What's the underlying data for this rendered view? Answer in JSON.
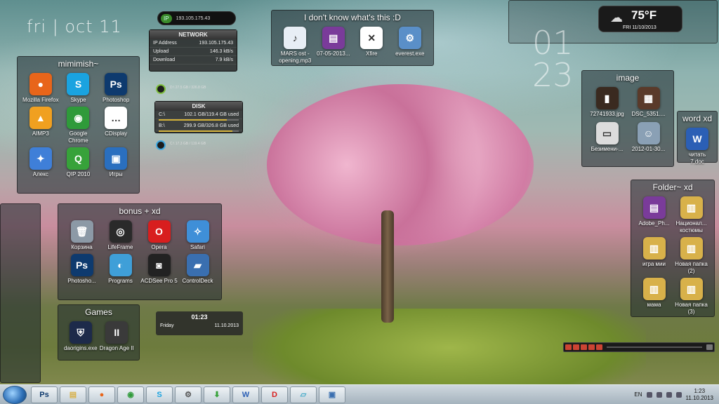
{
  "date_text": "fri | oct 11",
  "ip_widget": {
    "tag": "IP",
    "value": "193.105.175.43"
  },
  "network": {
    "title": "NETWORK",
    "rows": [
      {
        "label": "IP Address",
        "value": "193.105.175.43"
      },
      {
        "label": "Upload",
        "value": "146.3 kB/s"
      },
      {
        "label": "Download",
        "value": "7.9 kB/s"
      }
    ]
  },
  "drive_d_text": "D:\\ 27.5 GB / 326.8 GB",
  "drive_c_text": "C:\\ 17.3 GB / 119.4 GB",
  "disk": {
    "title": "DISK",
    "rows": [
      {
        "drive": "C:\\",
        "usage": "102.1 GB/119.4 GB used",
        "fill": 0.855
      },
      {
        "drive": "B:\\",
        "usage": "299.9 GB/326.8 GB used",
        "fill": 0.918
      }
    ]
  },
  "mimimish": {
    "title": "mimimish~",
    "items": [
      {
        "label": "Mozilla Firefox",
        "color": "#e8651a",
        "glyph": "●"
      },
      {
        "label": "Skype",
        "color": "#1aa3e0",
        "glyph": "S"
      },
      {
        "label": "Photoshop",
        "color": "#0e3a6e",
        "glyph": "Ps"
      },
      {
        "label": "AIMP3",
        "color": "#f0a020",
        "glyph": "▲"
      },
      {
        "label": "Google Chrome",
        "color": "#2f9a3a",
        "glyph": "◉"
      },
      {
        "label": "CDisplay",
        "color": "#ffffff",
        "glyph": "…"
      },
      {
        "label": "Алекс",
        "color": "#3f7fd8",
        "glyph": "✦"
      },
      {
        "label": "QIP 2010",
        "color": "#37a23a",
        "glyph": "Q"
      },
      {
        "label": "Игры",
        "color": "#2a6fbf",
        "glyph": "▣"
      }
    ]
  },
  "unknown_box": {
    "title": "I don't know what's this :D",
    "items": [
      {
        "label": "MARS ost - opening.mp3",
        "color": "#e8eef5",
        "glyph": "♪"
      },
      {
        "label": "07-05-2013...",
        "color": "#7a3b9a",
        "glyph": "▤"
      },
      {
        "label": "Xfire",
        "color": "#ffffff",
        "glyph": "✕"
      },
      {
        "label": "everest.exe",
        "color": "#5a8fc8",
        "glyph": "⚙"
      }
    ]
  },
  "clock": {
    "hour": "01",
    "minute": "23"
  },
  "weather": {
    "temp": "75°F",
    "date": "FRI 11/10/2013"
  },
  "image_box": {
    "title": "image",
    "items": [
      {
        "label": "72741933.jpg",
        "color": "#3a2a20",
        "glyph": "▮"
      },
      {
        "label": "DSC_5351....",
        "color": "#5a3a2a",
        "glyph": "▦"
      },
      {
        "label": "Безимени-...",
        "color": "#dcdcdc",
        "glyph": "▭"
      },
      {
        "label": "2012-01-30...",
        "color": "#8aa0b5",
        "glyph": "☺"
      }
    ]
  },
  "word_box": {
    "title": "word xd",
    "items": [
      {
        "label": "читать 7.doc",
        "color": "#2b5fb5",
        "glyph": "W"
      }
    ]
  },
  "bonus": {
    "title": "bonus + xd",
    "items": [
      {
        "label": "Корзина",
        "color": "#8c99a6",
        "glyph": "🗑"
      },
      {
        "label": "LifeFrame",
        "color": "#2a2a2a",
        "glyph": "◎"
      },
      {
        "label": "Opera",
        "color": "#d81e1e",
        "glyph": "O"
      },
      {
        "label": "Safari",
        "color": "#3f8fd8",
        "glyph": "✧"
      },
      {
        "label": "Photosho...",
        "color": "#0e3a6e",
        "glyph": "Ps"
      },
      {
        "label": "Programs",
        "color": "#3f9fd8",
        "glyph": "◐"
      },
      {
        "label": "ACDSee Pro 5",
        "color": "#222222",
        "glyph": "◙"
      },
      {
        "label": "ControlDeck",
        "color": "#3a6fb0",
        "glyph": "▰"
      }
    ]
  },
  "folder_box": {
    "title": "Folder~ xd",
    "items": [
      {
        "label": "Adobe_Ph...",
        "color": "#7a3b9a",
        "glyph": "▤"
      },
      {
        "label": "Национал... костюмы",
        "color": "#d8b14a",
        "glyph": "▥"
      },
      {
        "label": "игра мии",
        "color": "#d8b14a",
        "glyph": "▥"
      },
      {
        "label": "Новая папка (2)",
        "color": "#d8b14a",
        "glyph": "▥"
      },
      {
        "label": "мама",
        "color": "#d8b14a",
        "glyph": "▥"
      },
      {
        "label": "Новая папка (3)",
        "color": "#d8b14a",
        "glyph": "▥"
      }
    ]
  },
  "games": {
    "title": "Games",
    "items": [
      {
        "label": "daorigins.exe",
        "color": "#1d2a4a",
        "glyph": "⛨"
      },
      {
        "label": "Dragon Age II",
        "color": "#3a3a3a",
        "glyph": "II"
      }
    ]
  },
  "date_gadget": {
    "time": "01:23",
    "day": "Friday",
    "date": "11.10.2013"
  },
  "taskbar": {
    "items": [
      {
        "name": "photoshop",
        "glyph": "Ps",
        "color": "#0e3a6e"
      },
      {
        "name": "explorer",
        "glyph": "▤",
        "color": "#d8b14a"
      },
      {
        "name": "firefox",
        "glyph": "●",
        "color": "#e8651a"
      },
      {
        "name": "chrome",
        "glyph": "◉",
        "color": "#2f9a3a"
      },
      {
        "name": "skype",
        "glyph": "S",
        "color": "#1aa3e0"
      },
      {
        "name": "tools",
        "glyph": "⚙",
        "color": "#555555"
      },
      {
        "name": "download",
        "glyph": "⬇",
        "color": "#37a23a"
      },
      {
        "name": "word",
        "glyph": "W",
        "color": "#2b5fb5"
      },
      {
        "name": "daemon",
        "glyph": "D",
        "color": "#d81e1e"
      },
      {
        "name": "notes",
        "glyph": "▱",
        "color": "#3fa8c8"
      },
      {
        "name": "remote",
        "glyph": "▣",
        "color": "#3a6fb0"
      }
    ],
    "lang": "EN",
    "time": "1:23",
    "date": "11.10.2013"
  }
}
